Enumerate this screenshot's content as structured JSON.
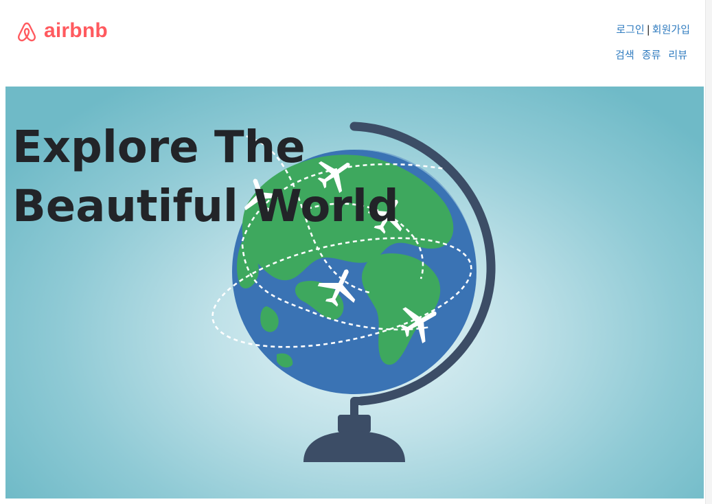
{
  "brand": {
    "name": "airbnb",
    "logo_icon": "airbnb-belo-icon",
    "color": "#ff5a5f"
  },
  "auth": {
    "login": "로그인",
    "separator": "|",
    "signup": "회원가입"
  },
  "nav": {
    "search": "검색",
    "types": "종류",
    "reviews": "리뷰"
  },
  "hero": {
    "title": "Explore The Beautiful World",
    "illustration": "globe-with-airplanes-icon"
  },
  "colors": {
    "link": "#2f7bbf",
    "title": "#222428",
    "ocean": "#3a73b4",
    "land": "#3ea85e",
    "stand": "#3c4d66",
    "background": "#6fbac7"
  }
}
